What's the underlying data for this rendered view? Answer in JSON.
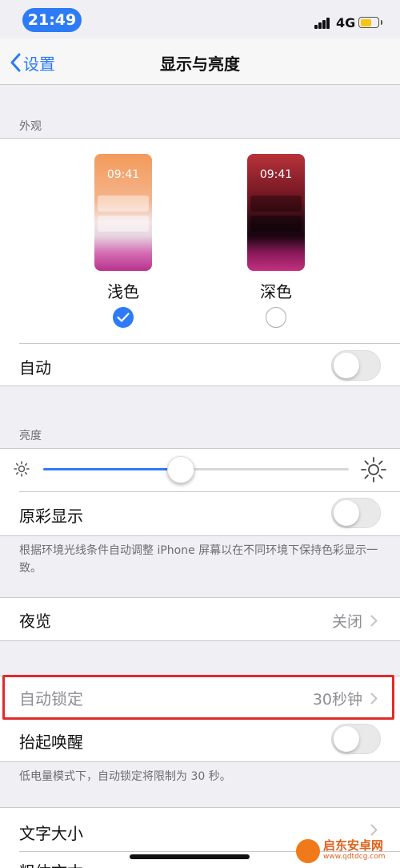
{
  "status_bar": {
    "time": "21:49",
    "network": "4G"
  },
  "nav": {
    "back_label": "设置",
    "title": "显示与亮度"
  },
  "appearance": {
    "header": "外观",
    "preview_time": "09:41",
    "light_label": "浅色",
    "dark_label": "深色",
    "selected": "浅色",
    "auto_label": "自动",
    "auto_on": false
  },
  "brightness": {
    "header": "亮度",
    "level": 0.45,
    "true_tone_label": "原彩显示",
    "true_tone_on": false,
    "footnote": "根据环境光线条件自动调整 iPhone 屏幕以在不同环境下保持色彩显示一致。"
  },
  "night_shift": {
    "label": "夜览",
    "value": "关闭"
  },
  "lock": {
    "auto_lock_label": "自动锁定",
    "auto_lock_value": "30秒钟",
    "raise_to_wake_label": "抬起唤醒",
    "raise_to_wake_on": false,
    "footnote": "低电量模式下，自动锁定将限制为 30 秒。"
  },
  "text": {
    "text_size_label": "文字大小",
    "bold_text_label": "粗体文本"
  },
  "watermark": {
    "name": "启东安卓网",
    "url": "www.qdtdcg.com"
  },
  "colors": {
    "accent": "#2d7bf6",
    "highlight_box": "#e02a2a",
    "background": "#efeff4"
  }
}
